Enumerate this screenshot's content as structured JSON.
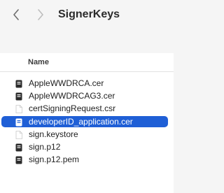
{
  "window": {
    "title": "SignerKeys"
  },
  "nav": {
    "back_icon": "chevron-left-icon",
    "forward_icon": "chevron-right-icon"
  },
  "list": {
    "column_header": "Name",
    "selected_color": "#1f5fd6",
    "items": [
      {
        "name": "AppleWWDRCA.cer",
        "icon": "certificate-icon",
        "selected": false
      },
      {
        "name": "AppleWWDRCAG3.cer",
        "icon": "certificate-icon",
        "selected": false
      },
      {
        "name": "certSigningRequest.csr",
        "icon": "document-icon",
        "selected": false
      },
      {
        "name": "developerID_application.cer",
        "icon": "certificate-icon",
        "selected": true
      },
      {
        "name": "sign.keystore",
        "icon": "document-icon",
        "selected": false
      },
      {
        "name": "sign.p12",
        "icon": "certificate-icon",
        "selected": false
      },
      {
        "name": "sign.p12.pem",
        "icon": "certificate-icon",
        "selected": false
      }
    ]
  }
}
